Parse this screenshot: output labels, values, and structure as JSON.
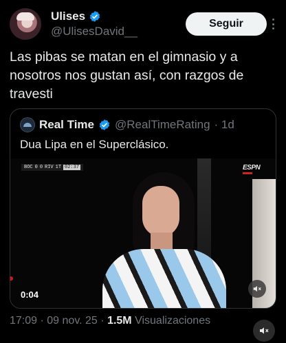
{
  "author": {
    "display_name": "Ulises",
    "handle": "@UlisesDavid__",
    "avatar_icon": "user-avatar",
    "verified_icon": "verified-badge-icon"
  },
  "follow_button": {
    "label": "Seguir"
  },
  "more_icon": "more-vertical-icon",
  "tweet": {
    "text": "Las pibas se matan en el gimnasio y a nosotros nos gustan así, con razgos de travesti"
  },
  "quoted": {
    "display_name": "Real Time",
    "handle": "@RealTimeRating",
    "age": "· 1d",
    "text": "Dua Lipa en el Superclásico.",
    "video": {
      "duration": "0:04",
      "scorebug": {
        "home": "BOC",
        "home_score": "0",
        "away_score": "0",
        "away": "RIV",
        "period": "1T",
        "clock": "02:37"
      },
      "channel": "ESPN",
      "sound_icon": "speaker-muted-icon"
    }
  },
  "meta": {
    "time": "17:09",
    "date": "09 nov. 25",
    "views_count": "1.5M",
    "views_label": "Visualizaciones"
  },
  "mute_icon": "speaker-muted-icon",
  "colors": {
    "background": "#000000",
    "text": "#e7e9ea",
    "secondary": "#71767b",
    "verified": "#1d9bf0",
    "border": "#2f3336"
  }
}
